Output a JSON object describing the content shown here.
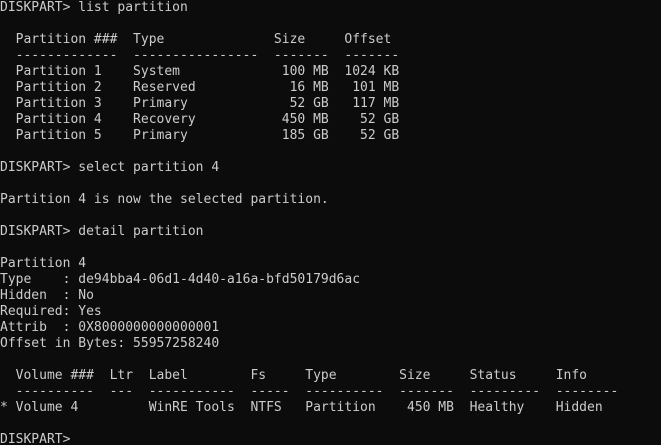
{
  "console": {
    "lines": [
      "DISKPART> list partition",
      "",
      "  Partition ###  Type              Size     Offset",
      "  -------------  ----------------  -------  -------",
      "  Partition 1    System             100 MB  1024 KB",
      "  Partition 2    Reserved            16 MB   101 MB",
      "  Partition 3    Primary             52 GB   117 MB",
      "  Partition 4    Recovery           450 MB    52 GB",
      "  Partition 5    Primary            185 GB    52 GB",
      "",
      "DISKPART> select partition 4",
      "",
      "Partition 4 is now the selected partition.",
      "",
      "DISKPART> detail partition",
      "",
      "Partition 4",
      "Type    : de94bba4-06d1-4d40-a16a-bfd50179d6ac",
      "Hidden  : No",
      "Required: Yes",
      "Attrib  : 0X8000000000000001",
      "Offset in Bytes: 55957258240",
      "",
      "  Volume ###  Ltr  Label        Fs     Type        Size     Status     Info",
      "  ----------  ---  -----------  -----  ----------  -------  ---------  --------",
      "* Volume 4         WinRE Tools  NTFS   Partition    450 MB  Healthy    Hidden",
      "",
      "DISKPART>"
    ]
  }
}
